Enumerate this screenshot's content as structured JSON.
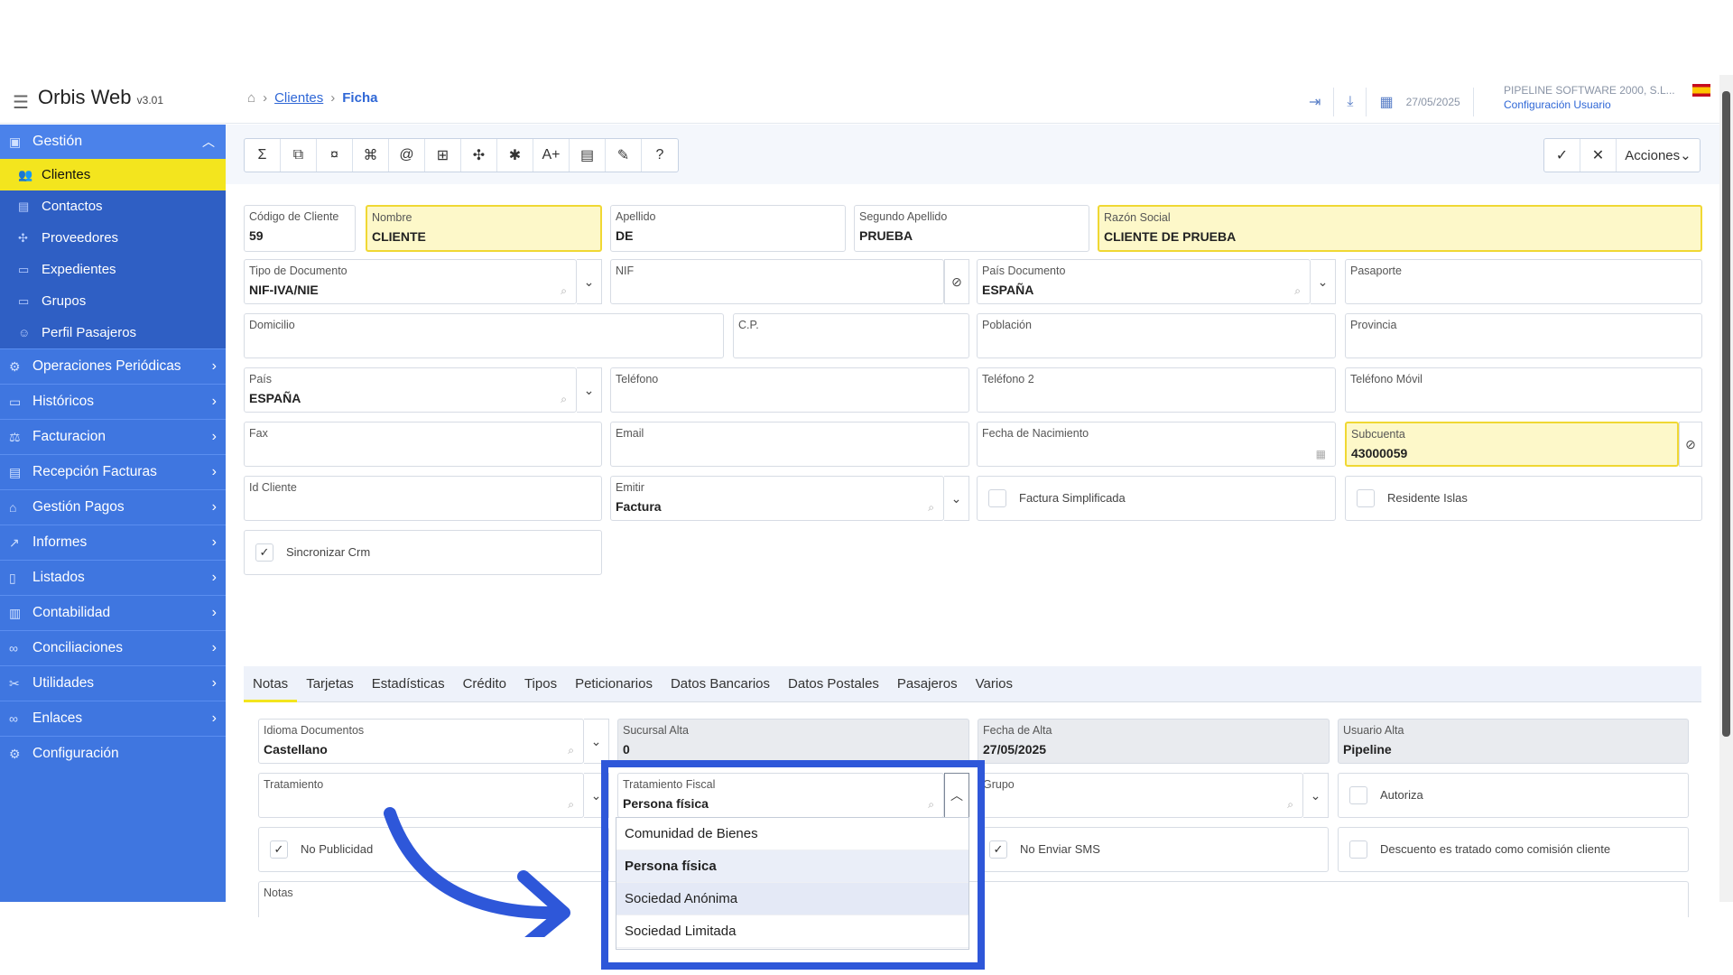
{
  "app": {
    "name": "Orbis Web",
    "version": "v3.01"
  },
  "breadcrumb": {
    "home_icon": "home-icon",
    "link": "Clientes",
    "current": "Ficha"
  },
  "header": {
    "date": "27/05/2025",
    "company": "PIPELINE SOFTWARE 2000, S.L...",
    "user_config": "Configuración Usuario"
  },
  "sidebar": {
    "group": "Gestión",
    "items": [
      "Clientes",
      "Contactos",
      "Proveedores",
      "Expedientes",
      "Grupos",
      "Perfil Pasajeros"
    ],
    "nav": [
      "Operaciones Periódicas",
      "Históricos",
      "Facturacion",
      "Recepción Facturas",
      "Gestión Pagos",
      "Informes",
      "Listados",
      "Contabilidad",
      "Conciliaciones",
      "Utilidades",
      "Enlaces",
      "Configuración"
    ]
  },
  "toolbar": {
    "actions_label": "Acciones"
  },
  "form": {
    "codigo": {
      "label": "Código de Cliente",
      "value": "59"
    },
    "nombre": {
      "label": "Nombre",
      "value": "CLIENTE"
    },
    "apellido": {
      "label": "Apellido",
      "value": "DE"
    },
    "segundo_apellido": {
      "label": "Segundo Apellido",
      "value": "PRUEBA"
    },
    "razon_social": {
      "label": "Razón Social",
      "value": "CLIENTE DE PRUEBA"
    },
    "tipo_documento": {
      "label": "Tipo de Documento",
      "value": "NIF-IVA/NIE"
    },
    "nif": {
      "label": "NIF",
      "value": ""
    },
    "pais_documento": {
      "label": "País Documento",
      "value": "ESPAÑA"
    },
    "pasaporte": {
      "label": "Pasaporte",
      "value": ""
    },
    "domicilio": {
      "label": "Domicilio",
      "value": ""
    },
    "cp": {
      "label": "C.P.",
      "value": ""
    },
    "poblacion": {
      "label": "Población",
      "value": ""
    },
    "provincia": {
      "label": "Provincia",
      "value": ""
    },
    "pais": {
      "label": "País",
      "value": "ESPAÑA"
    },
    "telefono": {
      "label": "Teléfono",
      "value": ""
    },
    "telefono2": {
      "label": "Teléfono 2",
      "value": ""
    },
    "telefono_movil": {
      "label": "Teléfono Móvil",
      "value": ""
    },
    "fax": {
      "label": "Fax",
      "value": ""
    },
    "email": {
      "label": "Email",
      "value": ""
    },
    "fecha_nacimiento": {
      "label": "Fecha de Nacimiento",
      "value": ""
    },
    "subcuenta": {
      "label": "Subcuenta",
      "value": "43000059"
    },
    "id_cliente": {
      "label": "Id Cliente",
      "value": ""
    },
    "emitir": {
      "label": "Emitir",
      "value": "Factura"
    },
    "factura_simplificada": "Factura Simplificada",
    "residente_islas": "Residente Islas",
    "sincronizar_crm": "Sincronizar Crm"
  },
  "tabs": [
    "Notas",
    "Tarjetas",
    "Estadísticas",
    "Crédito",
    "Tipos",
    "Peticionarios",
    "Datos Bancarios",
    "Datos Postales",
    "Pasajeros",
    "Varios"
  ],
  "notas_tab": {
    "idioma": {
      "label": "Idioma Documentos",
      "value": "Castellano"
    },
    "sucursal_alta": {
      "label": "Sucursal Alta",
      "value": "0"
    },
    "fecha_alta": {
      "label": "Fecha de Alta",
      "value": "27/05/2025"
    },
    "usuario_alta": {
      "label": "Usuario Alta",
      "value": "Pipeline"
    },
    "tratamiento": {
      "label": "Tratamiento",
      "value": ""
    },
    "tratamiento_fiscal": {
      "label": "Tratamiento Fiscal",
      "value": "Persona física"
    },
    "grupo": {
      "label": "Grupo",
      "value": ""
    },
    "autoriza": "Autoriza",
    "no_publicidad": "No Publicidad",
    "no_enviar_sms": "No Enviar SMS",
    "descuento": "Descuento es tratado como comisión cliente",
    "notas": {
      "label": "Notas"
    }
  },
  "dropdown_options": [
    "Comunidad de Bienes",
    "Persona física",
    "Sociedad Anónima",
    "Sociedad Limitada"
  ],
  "colors": {
    "accent": "#3f76e0",
    "highlight": "#f3e51e",
    "annotation": "#2e57d9"
  }
}
